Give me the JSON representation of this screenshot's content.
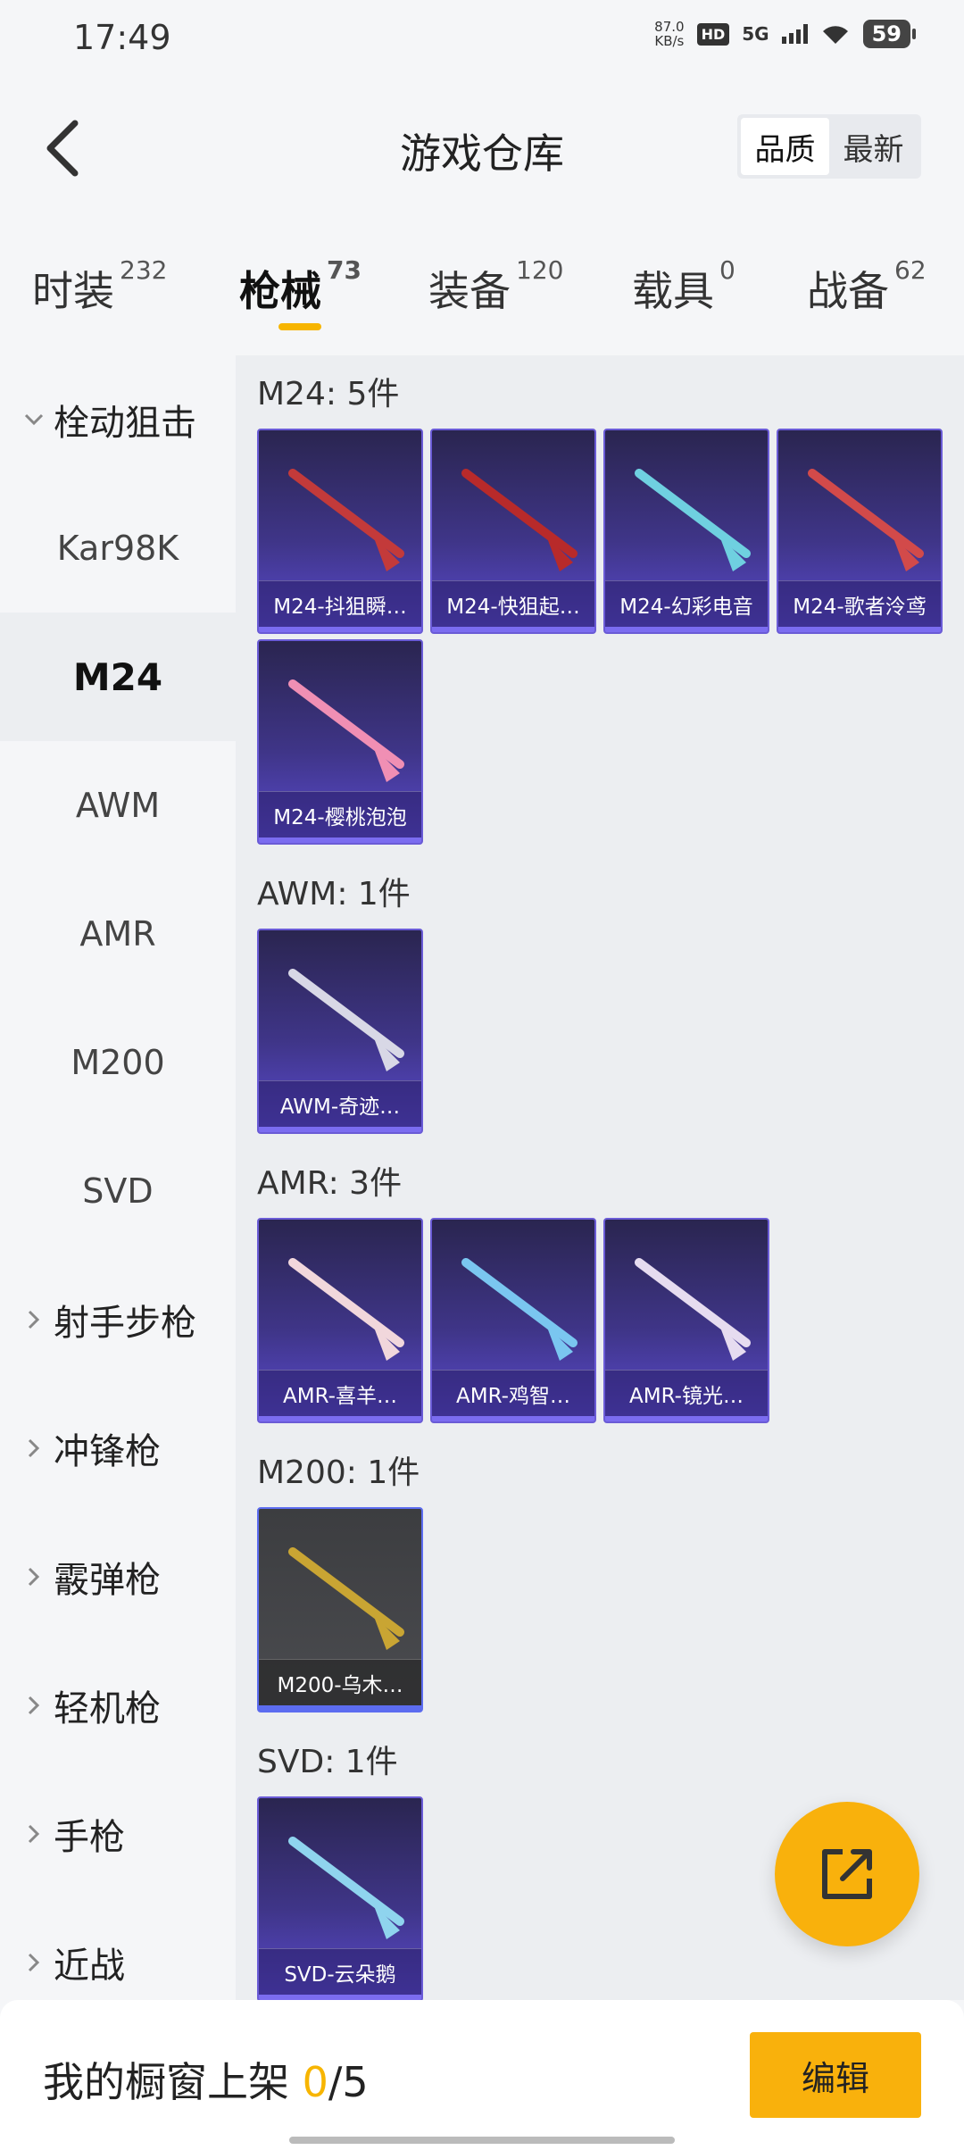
{
  "status": {
    "time": "17:49",
    "speed_top": "87.0",
    "speed_unit": "KB/s",
    "hd": "HD",
    "net": "5G",
    "battery": "59"
  },
  "header": {
    "title": "游戏仓库",
    "sort_quality": "品质",
    "sort_latest": "最新"
  },
  "tabs": [
    {
      "label": "时装",
      "count": "232"
    },
    {
      "label": "枪械",
      "count": "73"
    },
    {
      "label": "装备",
      "count": "120"
    },
    {
      "label": "载具",
      "count": "0"
    },
    {
      "label": "战备",
      "count": "62"
    }
  ],
  "sidebar": {
    "items": [
      {
        "label": "栓动狙击"
      },
      {
        "label": "Kar98K"
      },
      {
        "label": "M24"
      },
      {
        "label": "AWM"
      },
      {
        "label": "AMR"
      },
      {
        "label": "M200"
      },
      {
        "label": "SVD"
      },
      {
        "label": "射手步枪"
      },
      {
        "label": "冲锋枪"
      },
      {
        "label": "霰弹枪"
      },
      {
        "label": "轻机枪"
      },
      {
        "label": "手枪"
      },
      {
        "label": "近战"
      }
    ]
  },
  "sections": [
    {
      "title": "M24: 5件",
      "cards": [
        {
          "name": "M24-抖狙瞬…",
          "color": "#c33a3a"
        },
        {
          "name": "M24-快狙起…",
          "color": "#b82a2a"
        },
        {
          "name": "M24-幻彩电音",
          "color": "#6fd0e0"
        },
        {
          "name": "M24-歌者泠鸢",
          "color": "#d24a4a"
        },
        {
          "name": "M24-樱桃泡泡",
          "color": "#f08fb4"
        }
      ]
    },
    {
      "title": "AWM: 1件",
      "cards": [
        {
          "name": "AWM-奇迹…",
          "color": "#d8d8e6"
        }
      ]
    },
    {
      "title": "AMR: 3件",
      "cards": [
        {
          "name": "AMR-喜羊…",
          "color": "#f1d7dc"
        },
        {
          "name": "AMR-鸡智…",
          "color": "#7ac6f0"
        },
        {
          "name": "AMR-镜光…",
          "color": "#e6dcf0"
        }
      ]
    },
    {
      "title": "M200: 1件",
      "cards": [
        {
          "name": "M200-乌木…",
          "color": "#c9a533"
        }
      ]
    },
    {
      "title": "SVD: 1件",
      "cards": [
        {
          "name": "SVD-云朵鹅",
          "color": "#8fd4ee"
        }
      ]
    }
  ],
  "bottom": {
    "text": "我的橱窗上架 ",
    "count": "0",
    "total": "/5",
    "edit": "编辑"
  },
  "icons": {
    "back": "back-arrow-icon",
    "fab": "share-external-icon"
  }
}
